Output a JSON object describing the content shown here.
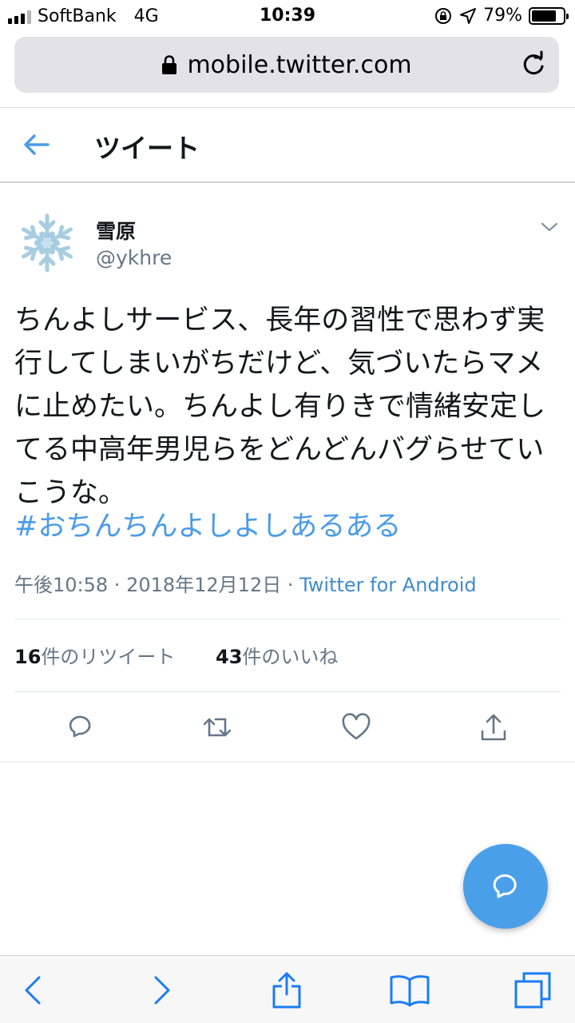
{
  "status_bar": {
    "carrier": "SoftBank",
    "network": "4G",
    "time": "10:39",
    "battery": "79%",
    "battery_level": 0.79,
    "icons": [
      "signal-bars-icon",
      "rotation-lock-icon",
      "location-arrow-icon",
      "battery-icon"
    ]
  },
  "browser": {
    "url": "mobile.twitter.com",
    "icons": [
      "lock-icon",
      "reload-icon"
    ]
  },
  "header": {
    "title": "ツイート",
    "back_icon": "back-arrow-icon"
  },
  "tweet": {
    "avatar_icon": "snowflake-avatar",
    "name": "雪原",
    "handle": "@ykhre",
    "text": "ちんよしサービス、長年の習性で思わず実行してしまいがちだけど、気づいたらマメに止めたい。ちんよし有りきで情緒安定してる中高年男児らをどんどんバグらせていこうな。",
    "hashtag": "#おちんちんよしよしあるある",
    "time": "午後10:58",
    "date": "2018年12月12日",
    "separator": " · ",
    "source": "Twitter for Android",
    "retweet_count": "16",
    "retweet_label": "件のリツイート",
    "like_count": "43",
    "like_label": "件のいいね"
  },
  "actions": [
    "reply-icon",
    "retweet-icon",
    "like-icon",
    "share-icon"
  ],
  "colors": {
    "twitter_blue": "#4a9be8",
    "fab_blue": "#4a9fe9",
    "secondary_text": "#657786",
    "ios_blue": "#1a7cf6"
  }
}
